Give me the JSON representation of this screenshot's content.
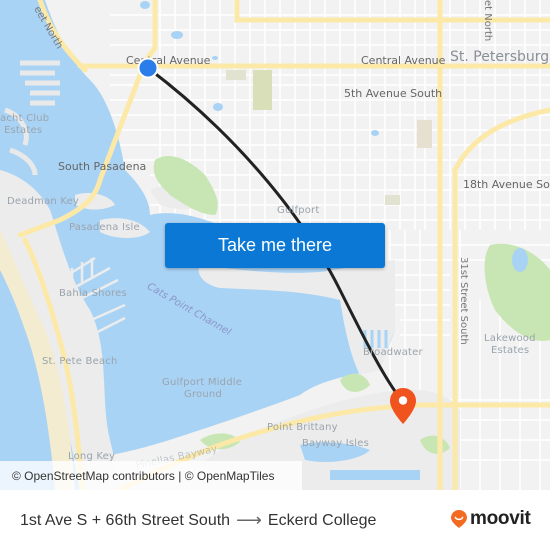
{
  "map": {
    "labels": {
      "street_north": "eet North",
      "central_avenue_west": "Central Avenue",
      "central_avenue_east": "Central Avenue",
      "st_petersburg": "St. Petersburg",
      "fifth_ave_south": "5th Avenue South",
      "street_north_right": "et North",
      "yacht_club_estates_1": "acht Club",
      "yacht_club_estates_2": "Estates",
      "south_pasadena": "South Pasadena",
      "eighteenth_ave": "18th Avenue Sou",
      "deadman_key": "Deadman Key",
      "gulfport": "Gulfport",
      "pasadena_isle": "Pasadena Isle",
      "thirty_first_street": "31st Street South",
      "bahia_shores": "Bahia Shores",
      "cats_point_channel": "Cats Point Channel",
      "lakewood_estates_1": "Lakewood",
      "lakewood_estates_2": "Estates",
      "broadwater": "Broadwater",
      "st_pete_beach": "St. Pete Beach",
      "gulfport_middle_ground_1": "Gulfport Middle",
      "gulfport_middle_ground_2": "Ground",
      "point_brittany": "Point Brittany",
      "bayway_isles": "Bayway Isles",
      "long_key": "Long Key",
      "pinellas_bayway": "Pinellas Bayway"
    },
    "origin_marker_color": "#2b7de9",
    "destination_marker_color": "#f0531e",
    "route_color": "#222222",
    "water_color": "#a9d3f5",
    "park_color": "#c8e6b3",
    "road_color": "#fce9a8"
  },
  "cta": {
    "label": "Take me there",
    "color": "#0b78d6"
  },
  "attribution": "© OpenStreetMap contributors | © OpenMapTiles",
  "footer": {
    "origin": "1st Ave S + 66th Street South",
    "arrow": "⟶",
    "destination": "Eckerd College",
    "brand": "moovit",
    "brand_color": "#f26b21"
  }
}
